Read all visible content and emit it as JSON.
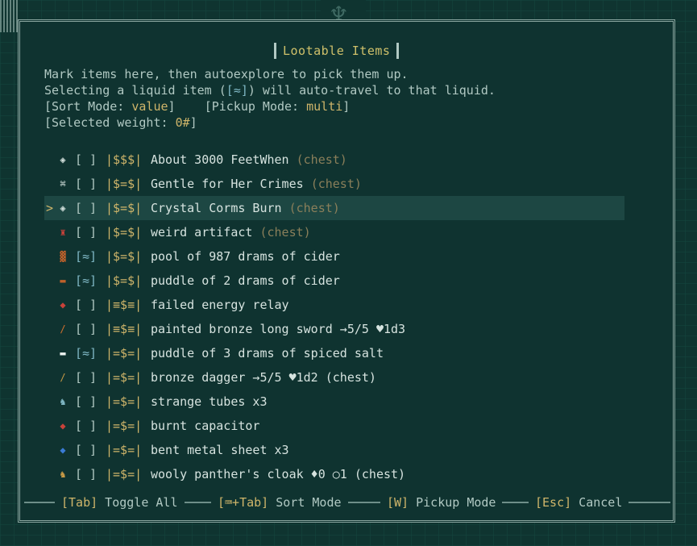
{
  "title": "Lootable Items",
  "info": {
    "line1": "Mark items here, then autoexplore to pick them up.",
    "line2_pre": "Selecting a liquid item (",
    "line2_sym": "[≈]",
    "line2_post": ") will auto-travel to that liquid.",
    "sort_label": "[Sort Mode: ",
    "sort_value": "value",
    "sort_close": "]",
    "pickup_label": "[Pickup Mode: ",
    "pickup_value": "multi",
    "pickup_close": "]",
    "weight_label": "[Selected weight: ",
    "weight_value": "0#",
    "weight_close": "]"
  },
  "items": [
    {
      "icon": "scroll-icon",
      "glyph": "◈",
      "glyph_color": "#d6e3df",
      "mark": "[ ]",
      "val": "|$$$|",
      "name": "About 3000 FeetWhen ",
      "suffix": "(chest)"
    },
    {
      "icon": "book-icon",
      "glyph": "⌘",
      "glyph_color": "#d6e3df",
      "mark": "[ ]",
      "val": "|$=$|",
      "name": "Gentle for Her Crimes ",
      "suffix": "(chest)"
    },
    {
      "icon": "scroll-icon",
      "glyph": "◈",
      "glyph_color": "#d6e3df",
      "mark": "[ ]",
      "val": "|$=$|",
      "name": "Crystal Corms Burn ",
      "suffix": "(chest)",
      "selected": true,
      "cursor": ">"
    },
    {
      "icon": "artifact-icon",
      "glyph": "♜",
      "glyph_color": "#c8423a",
      "mark": "[ ]",
      "val": "|$=$|",
      "name": "weird artifact ",
      "suffix": "(chest)"
    },
    {
      "icon": "pool-icon",
      "glyph": "▓",
      "glyph_color": "#c0612a",
      "mark": "[≈]",
      "val": "|$=$|",
      "name": "pool of 987 drams of cider"
    },
    {
      "icon": "puddle-icon",
      "glyph": "▬",
      "glyph_color": "#c0612a",
      "mark": "[≈]",
      "val": "|$=$|",
      "name": "puddle of 2 drams of cider"
    },
    {
      "icon": "relay-icon",
      "glyph": "◆",
      "glyph_color": "#c8423a",
      "mark": "[ ]",
      "val": "|≡$≡|",
      "name": "failed energy relay"
    },
    {
      "icon": "sword-icon",
      "glyph": "/",
      "glyph_color": "#d2702e",
      "mark": "[ ]",
      "val": "|≡$≡|",
      "name": "painted bronze long sword →5/5 ♥1d3"
    },
    {
      "icon": "puddle-icon",
      "glyph": "▬",
      "glyph_color": "#eef5f2",
      "mark": "[≈]",
      "val": "|=$=|",
      "name": "puddle of 3 drams of spiced salt"
    },
    {
      "icon": "dagger-icon",
      "glyph": "/",
      "glyph_color": "#c79a46",
      "mark": "[ ]",
      "val": "|=$=|",
      "name": "bronze dagger →5/5 ♥1d2 (chest)"
    },
    {
      "icon": "tubes-icon",
      "glyph": "♞",
      "glyph_color": "#7fb7c4",
      "mark": "[ ]",
      "val": "|=$=|",
      "name": "strange tubes x3"
    },
    {
      "icon": "capacitor-icon",
      "glyph": "◆",
      "glyph_color": "#c8423a",
      "mark": "[ ]",
      "val": "|=$=|",
      "name": "burnt capacitor"
    },
    {
      "icon": "metal-sheet-icon",
      "glyph": "◆",
      "glyph_color": "#3a7bd5",
      "mark": "[ ]",
      "val": "|=$=|",
      "name": "bent metal sheet x3"
    },
    {
      "icon": "cloak-icon",
      "glyph": "♞",
      "glyph_color": "#c79a46",
      "mark": "[ ]",
      "val": "|=$=|",
      "name": "wooly panther's cloak ♦0 ○1 (chest)"
    }
  ],
  "footer": [
    {
      "key": "[Tab]",
      "label": " Toggle All"
    },
    {
      "key": "[⌨+Tab]",
      "label": " Sort Mode"
    },
    {
      "key": "[W]",
      "label": " Pickup Mode"
    },
    {
      "key": "[Esc]",
      "label": " Cancel"
    }
  ]
}
